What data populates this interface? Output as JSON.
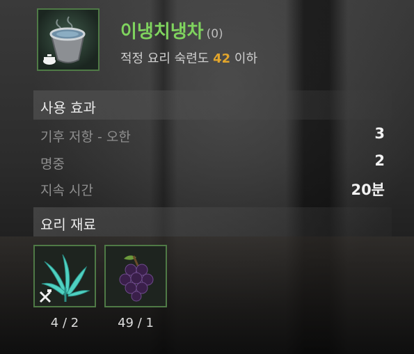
{
  "item": {
    "icon": "tea-cup-icon",
    "name": "이냉치냉차",
    "count": "(0)",
    "requirement_prefix": "적정 요리 숙련도",
    "requirement_level": "42",
    "requirement_suffix": "이하"
  },
  "effects": {
    "header": "사용 효과",
    "rows": [
      {
        "label": "기후 저항 - 오한",
        "value": "3"
      },
      {
        "label": "명중",
        "value": "2"
      },
      {
        "label": "지속 시간",
        "value": "20분"
      }
    ]
  },
  "ingredients": {
    "header": "요리 재료",
    "items": [
      {
        "icon": "herb-leaf-icon",
        "quantity": "4 / 2"
      },
      {
        "icon": "grape-icon",
        "quantity": "49 / 1"
      }
    ]
  },
  "colors": {
    "item_name": "#7fd35e",
    "level_highlight": "#e2a52b",
    "frame_border": "#4f7a46"
  }
}
